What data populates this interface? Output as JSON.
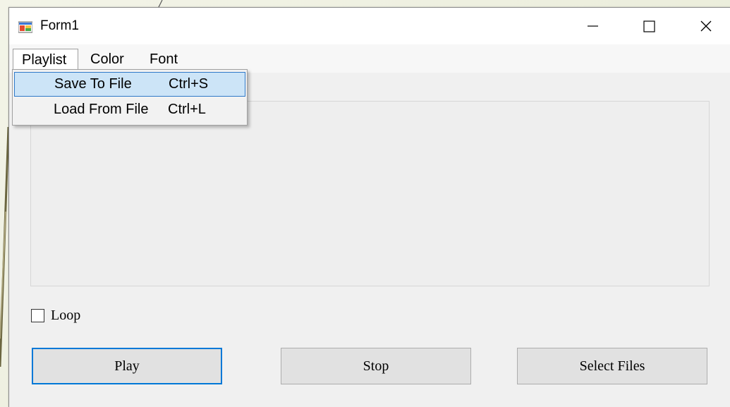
{
  "window": {
    "title": "Form1"
  },
  "menubar": {
    "items": [
      {
        "label": "Playlist",
        "open": true
      },
      {
        "label": "Color"
      },
      {
        "label": "Font"
      }
    ]
  },
  "dropdown": {
    "items": [
      {
        "label": "Save To File",
        "shortcut": "Ctrl+S",
        "highlighted": true
      },
      {
        "label": "Load From File",
        "shortcut": "Ctrl+L"
      }
    ]
  },
  "loop": {
    "label": "Loop",
    "checked": false
  },
  "buttons": {
    "play": "Play",
    "stop": "Stop",
    "select_files": "Select Files"
  },
  "colors": {
    "accent": "#0078d7",
    "highlight": "#cce4f7"
  },
  "icons": {
    "app": "form-app-icon",
    "minimize": "minimize-icon",
    "maximize": "maximize-icon",
    "close": "close-icon"
  }
}
